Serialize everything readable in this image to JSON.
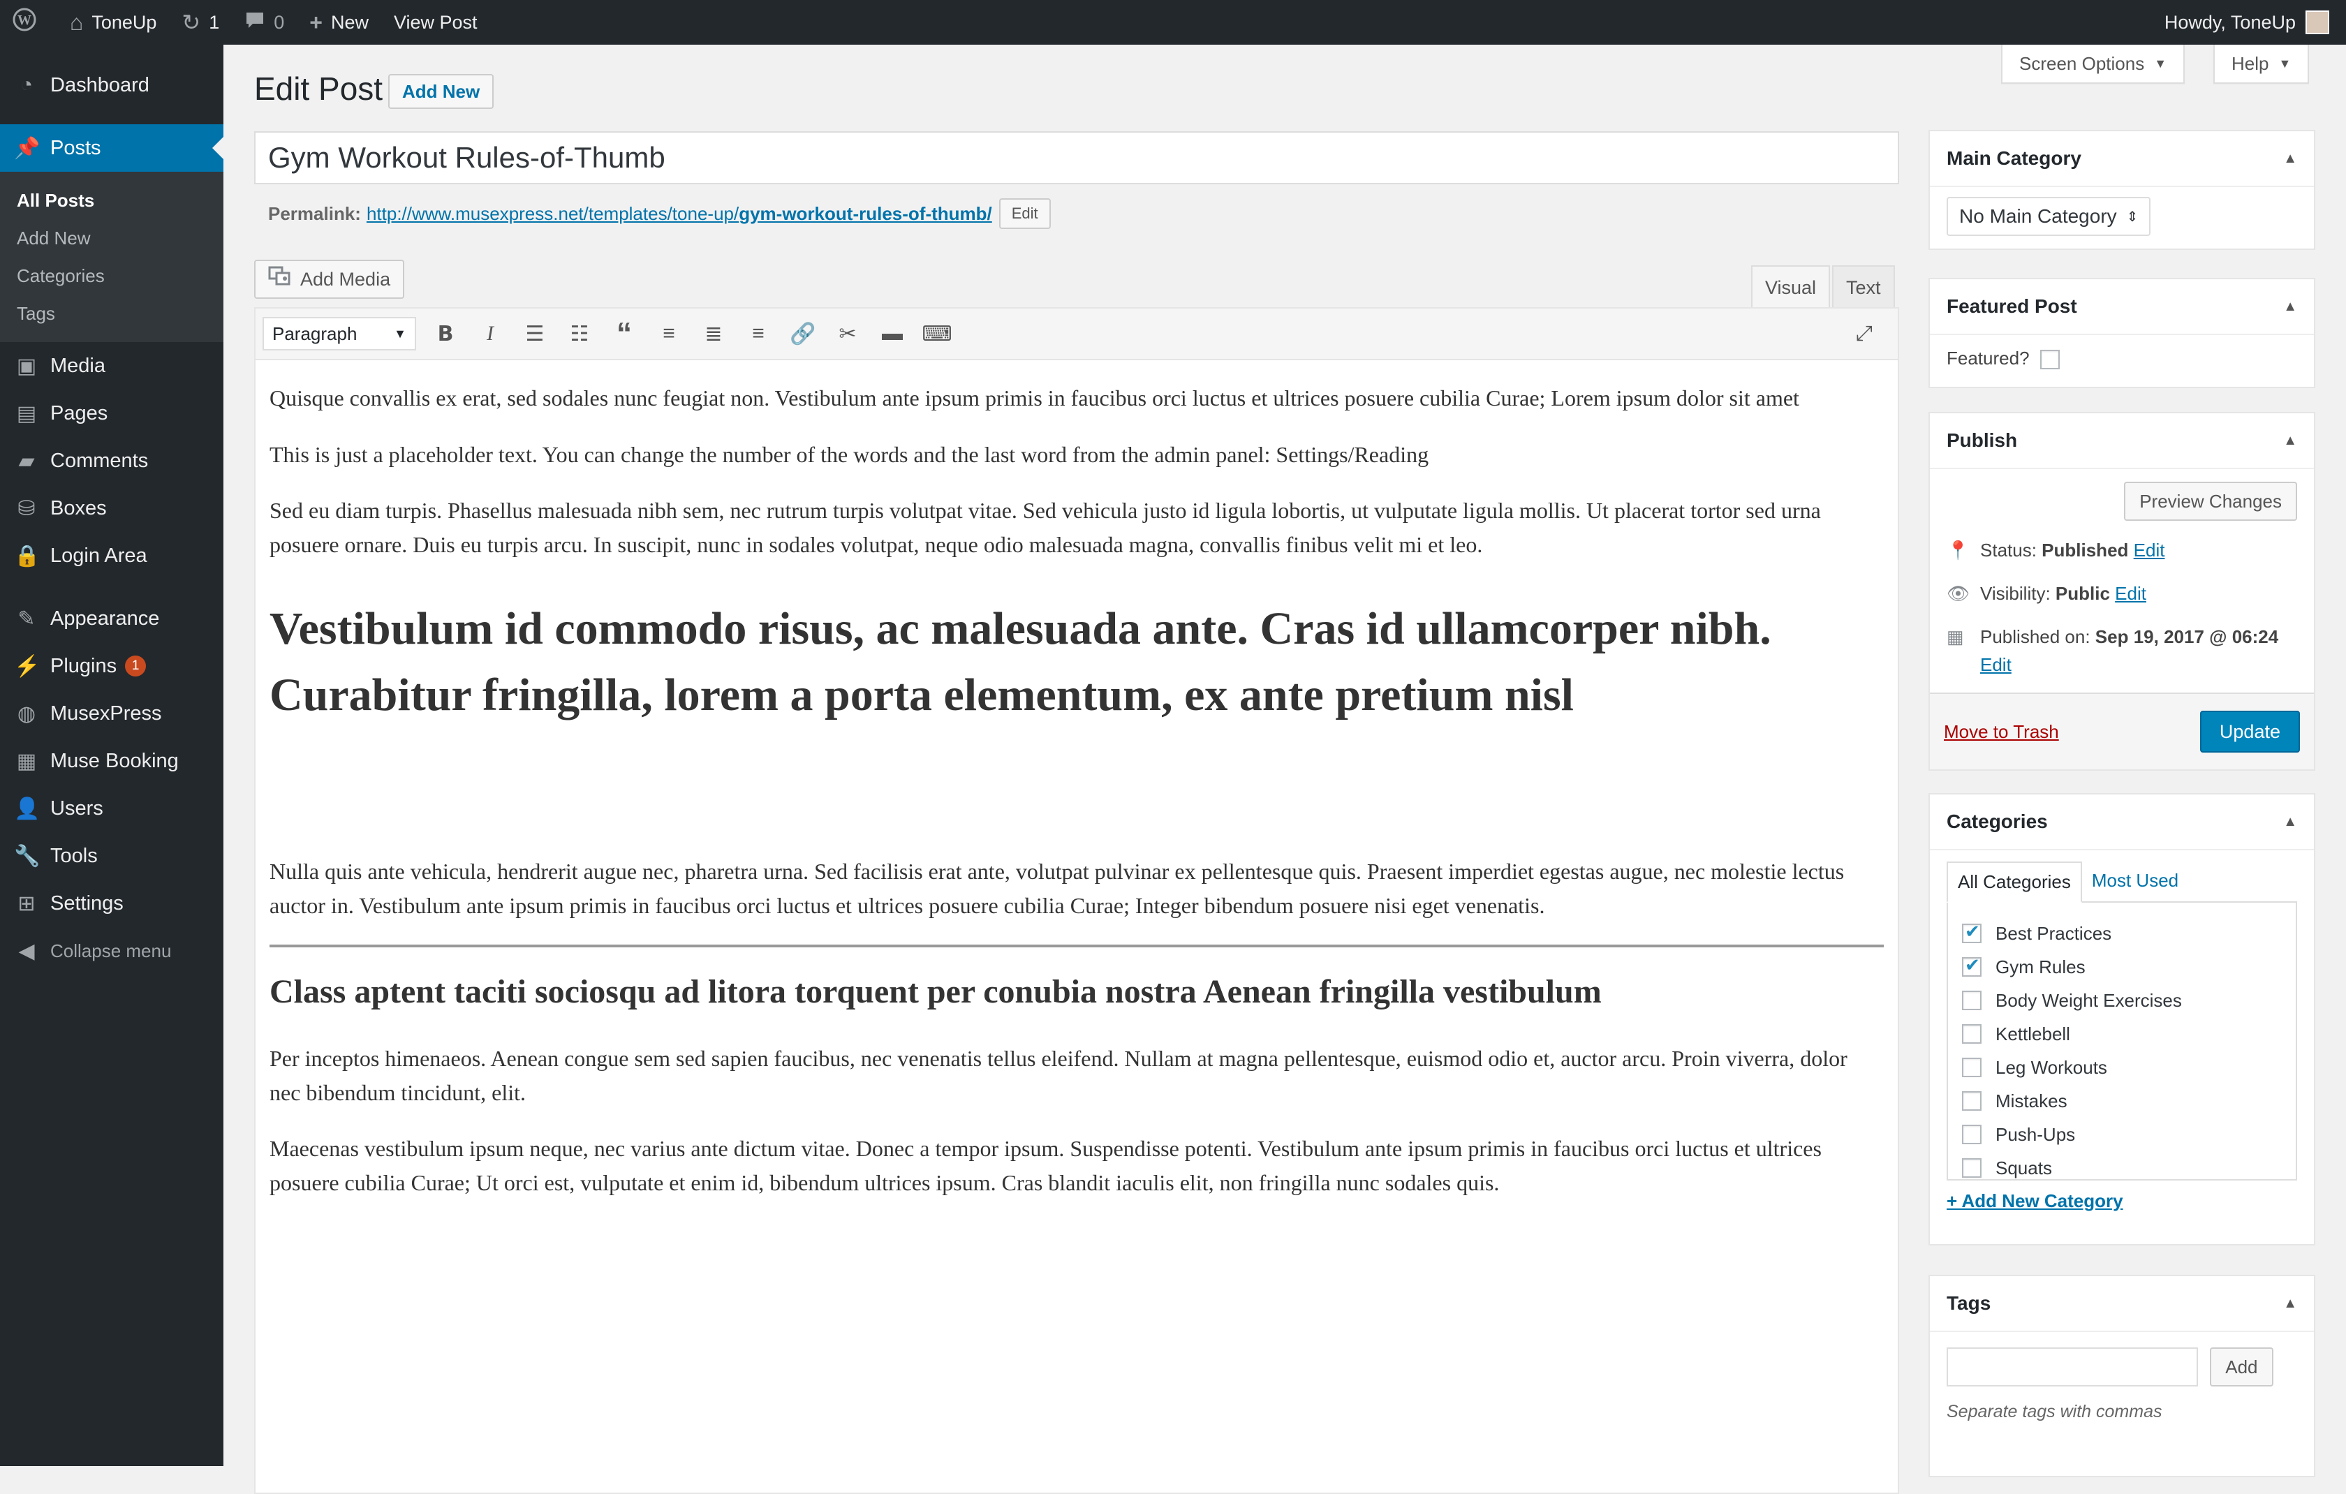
{
  "adminbar": {
    "site_name": "ToneUp",
    "updates_count": "1",
    "comments_count": "0",
    "new_label": "New",
    "view_post_label": "View Post",
    "howdy": "Howdy, ToneUp"
  },
  "sidebar": {
    "dashboard": "Dashboard",
    "posts": "Posts",
    "submenu": [
      "All Posts",
      "Add New",
      "Categories",
      "Tags"
    ],
    "media": "Media",
    "pages": "Pages",
    "comments": "Comments",
    "boxes": "Boxes",
    "login_area": "Login Area",
    "appearance": "Appearance",
    "plugins": "Plugins",
    "plugins_badge": "1",
    "musexpress": "MusexPress",
    "muse_booking": "Muse Booking",
    "users": "Users",
    "tools": "Tools",
    "settings": "Settings",
    "collapse": "Collapse menu"
  },
  "screen_options": {
    "screen_options_label": "Screen Options",
    "help_label": "Help"
  },
  "header": {
    "title": "Edit Post",
    "add_new_label": "Add New"
  },
  "post": {
    "title": "Gym Workout Rules-of-Thumb",
    "permalink_label": "Permalink:",
    "permalink_base": "http://www.musexpress.net/templates/tone-up/",
    "permalink_slug": "gym-workout-rules-of-thumb/",
    "permalink_edit": "Edit"
  },
  "editor": {
    "add_media_label": "Add Media",
    "tab_visual": "Visual",
    "tab_text": "Text",
    "format_value": "Paragraph",
    "content": {
      "p1": "Quisque convallis ex erat, sed sodales nunc feugiat non. Vestibulum ante ipsum primis in faucibus orci luctus et ultrices posuere cubilia Curae; Lorem ipsum dolor sit amet",
      "p2": "This is just a placeholder text. You can change the number of the words and the last word from the admin panel: Settings/Reading",
      "p3": "Sed eu diam turpis. Phasellus malesuada nibh sem, nec rutrum turpis volutpat vitae. Sed vehicula justo id ligula lobortis, ut vulputate ligula mollis. Ut placerat tortor sed urna posuere ornare. Duis eu turpis arcu. In suscipit, nunc in sodales volutpat, neque odio malesuada magna, convallis finibus velit mi et leo.",
      "h2": "Vestibulum id commodo risus, ac malesuada ante. Cras id ullamcorper nibh. Curabitur fringilla, lorem a porta elementum, ex ante pretium nisl",
      "p4": "Nulla quis ante vehicula, hendrerit augue nec, pharetra urna. Sed facilisis erat ante, volutpat pulvinar ex pellentesque quis. Praesent imperdiet egestas augue, nec molestie lectus auctor in. Vestibulum ante ipsum primis in faucibus orci luctus et ultrices posuere cubilia Curae; Integer bibendum posuere nisi eget venenatis.",
      "h3": "Class aptent taciti sociosqu ad litora torquent per conubia nostra Aenean fringilla vestibulum",
      "p5": "Per inceptos himenaeos. Aenean congue sem sed sapien faucibus, nec venenatis tellus eleifend. Nullam at magna pellentesque, euismod odio et, auctor arcu. Proin viverra, dolor nec bibendum tincidunt, elit.",
      "p6": "Maecenas vestibulum ipsum neque, nec varius ante dictum vitae. Donec a tempor ipsum. Suspendisse potenti. Vestibulum ante ipsum primis in faucibus orci luctus et ultrices posuere cubilia Curae; Ut orci est, vulputate et enim id, bibendum ultrices ipsum. Cras blandit iaculis elit, non fringilla nunc sodales quis."
    }
  },
  "main_category": {
    "title": "Main Category",
    "selected": "No Main Category"
  },
  "featured_post": {
    "title": "Featured Post",
    "label": "Featured?"
  },
  "publish": {
    "title": "Publish",
    "preview_label": "Preview Changes",
    "status_label": "Status:",
    "status_value": "Published",
    "visibility_label": "Visibility:",
    "visibility_value": "Public",
    "published_label": "Published on:",
    "published_value": "Sep 19, 2017 @ 06:24",
    "edit_label": "Edit",
    "trash_label": "Move to Trash",
    "update_label": "Update"
  },
  "categories": {
    "title": "Categories",
    "tab_all": "All Categories",
    "tab_most_used": "Most Used",
    "items": [
      {
        "name": "Best Practices",
        "checked": true
      },
      {
        "name": "Gym Rules",
        "checked": true
      },
      {
        "name": "Body Weight Exercises",
        "checked": false
      },
      {
        "name": "Kettlebell",
        "checked": false
      },
      {
        "name": "Leg Workouts",
        "checked": false
      },
      {
        "name": "Mistakes",
        "checked": false
      },
      {
        "name": "Push-Ups",
        "checked": false
      },
      {
        "name": "Squats",
        "checked": false
      }
    ],
    "add_new_label": "+ Add New Category"
  },
  "tags": {
    "title": "Tags",
    "add_label": "Add",
    "hint": "Separate tags with commas"
  },
  "colors": {
    "accent": "#0073aa",
    "sidebar": "#23282d",
    "primary_button": "#0085ba",
    "badge": "#ca4a1f"
  }
}
